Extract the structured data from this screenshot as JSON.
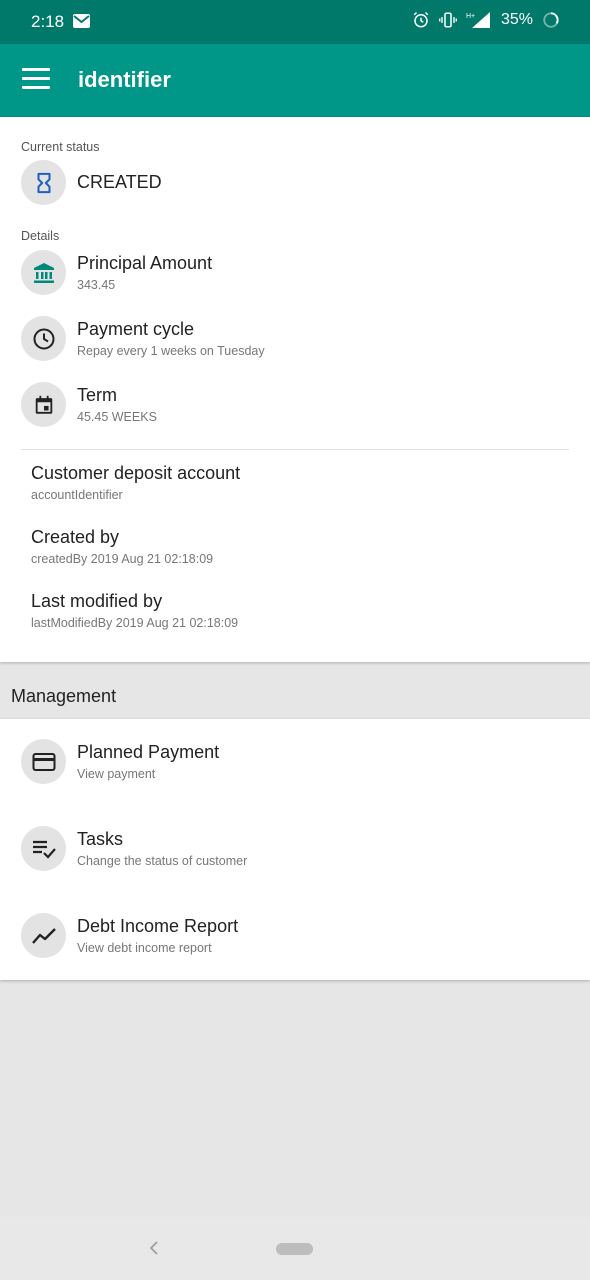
{
  "status_bar": {
    "time": "2:18",
    "battery": "35%",
    "icons": [
      "gmail-icon",
      "alarm-icon",
      "vibrate-icon",
      "signal-icon",
      "battery-ring-icon"
    ]
  },
  "app_bar": {
    "title": "identifier",
    "menu_icon": "menu-icon",
    "color": "#009688",
    "status_color": "#00796b"
  },
  "current_status": {
    "label": "Current status",
    "value": "CREATED",
    "icon": "hourglass-icon"
  },
  "details": {
    "label": "Details",
    "items": [
      {
        "title": "Principal Amount",
        "subtitle": "343.45",
        "icon": "bank-icon"
      },
      {
        "title": "Payment cycle",
        "subtitle": "Repay every 1 weeks on Tuesday",
        "icon": "clock-icon"
      },
      {
        "title": "Term",
        "subtitle": "45.45 WEEKS",
        "icon": "calendar-icon"
      }
    ]
  },
  "info": [
    {
      "title": "Customer deposit account",
      "subtitle": "accountIdentifier"
    },
    {
      "title": "Created by",
      "subtitle": "createdBy 2019 Aug 21 02:18:09"
    },
    {
      "title": "Last modified by",
      "subtitle": "lastModifiedBy 2019 Aug 21 02:18:09"
    }
  ],
  "management": {
    "header": "Management",
    "items": [
      {
        "title": "Planned Payment",
        "subtitle": "View payment",
        "icon": "credit-card-icon"
      },
      {
        "title": "Tasks",
        "subtitle": "Change the status of customer",
        "icon": "playlist-check-icon"
      },
      {
        "title": "Debt Income Report",
        "subtitle": "View debt income report",
        "icon": "trending-icon"
      }
    ]
  },
  "nav_bar": {
    "back_icon": "back-chevron-icon",
    "home_icon": "home-pill-icon"
  }
}
